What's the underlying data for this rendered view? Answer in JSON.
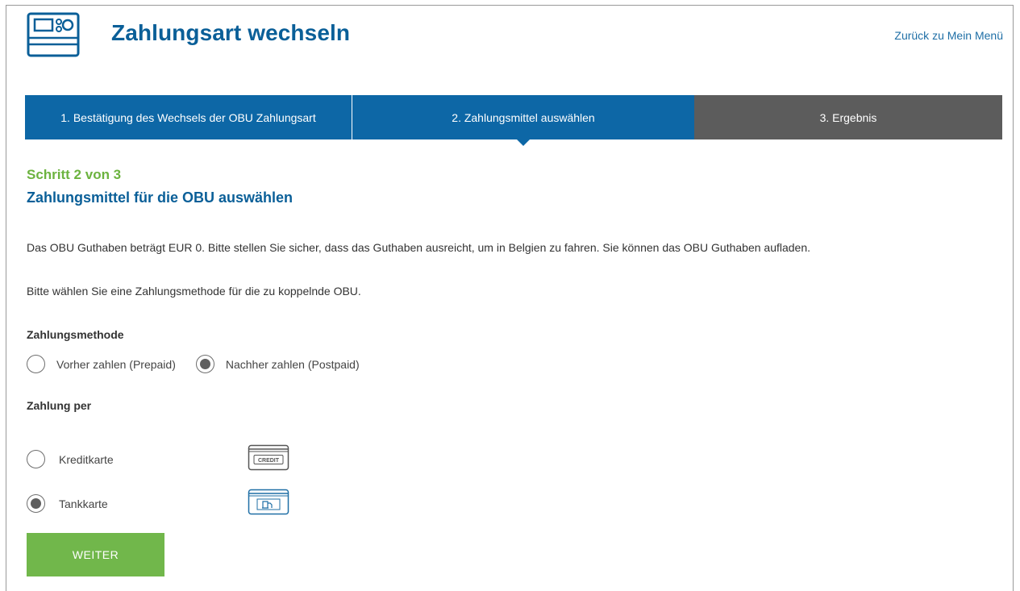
{
  "header": {
    "title": "Zahlungsart wechseln",
    "back_link": "Zurück zu Mein Menü",
    "logo_icon": "obu-device-icon"
  },
  "steps": [
    {
      "label": "1. Bestätigung des Wechsels der OBU Zahlungsart",
      "state": "completed"
    },
    {
      "label": "2. Zahlungsmittel auswählen",
      "state": "active"
    },
    {
      "label": "3. Ergebnis",
      "state": "pending"
    }
  ],
  "content": {
    "step_counter": "Schritt 2 von 3",
    "heading": "Zahlungsmittel für die OBU auswählen",
    "balance_text": "Das OBU Guthaben beträgt EUR 0. Bitte stellen Sie sicher, dass das Guthaben ausreicht, um in Belgien zu fahren. Sie können das OBU Guthaben aufladen.",
    "instruction_text": "Bitte wählen Sie eine Zahlungsmethode für die zu koppelnde OBU.",
    "payment_method": {
      "label": "Zahlungsmethode",
      "options": [
        {
          "label": "Vorher zahlen (Prepaid)",
          "selected": false
        },
        {
          "label": "Nachher zahlen (Postpaid)",
          "selected": true
        }
      ]
    },
    "payment_by": {
      "label": "Zahlung per",
      "options": [
        {
          "label": "Kreditkarte",
          "selected": false,
          "icon": "credit-card-icon",
          "icon_text": "CREDIT"
        },
        {
          "label": "Tankkarte",
          "selected": true,
          "icon": "fuel-card-icon"
        }
      ]
    },
    "submit_label": "WEITER"
  },
  "colors": {
    "brand_blue": "#0d67a6",
    "step_inactive": "#5c5c5c",
    "accent_green": "#71b74b",
    "step_counter_green": "#6cb33f"
  }
}
